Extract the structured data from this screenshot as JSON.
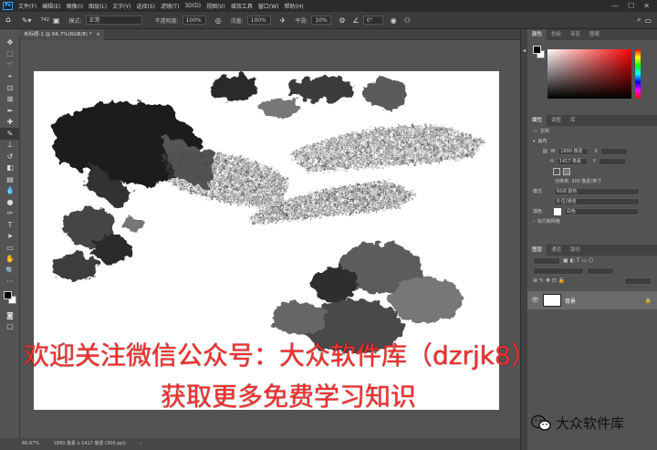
{
  "menubar": {
    "logo": "Ps",
    "items": [
      "文件(F)",
      "编辑(E)",
      "图像(I)",
      "图层(L)",
      "文字(Y)",
      "选择(S)",
      "滤镜(T)",
      "3D(D)",
      "视图(V)",
      "增效工具",
      "窗口(W)",
      "帮助(H)"
    ],
    "window_buttons": [
      "—",
      "☐",
      "✕"
    ]
  },
  "options": {
    "brush_size": "742",
    "mode_label": "模式:",
    "mode_value": "正常",
    "opacity_label": "不透明度:",
    "opacity_value": "100%",
    "flow_label": "流量:",
    "flow_value": "100%",
    "smooth_label": "平滑:",
    "smooth_value": "10%",
    "angle_value": "0°"
  },
  "document": {
    "tab_title": "未标题-1 @ 66.7%(RGB/8) *",
    "tab_close": "×"
  },
  "status": {
    "zoom": "66.67%",
    "info": "1890 像素 x 1417 像素 (300 ppi)",
    "arrow": "›"
  },
  "right_panel": {
    "color_tabs": [
      "颜色",
      "色板",
      "渐变",
      "图案"
    ],
    "props_tabs": [
      "属性",
      "调整",
      "库"
    ],
    "doc_label": "文档",
    "canvas_section": "画布",
    "w_label": "W",
    "w_value": "1890 像素",
    "h_label": "H",
    "h_value": "1417 像素",
    "x_label": "X",
    "y_label": "Y",
    "resolution": "分辨率: 300 像素/英寸",
    "mode_label": "模式",
    "mode_value": "RGB 颜色",
    "bit_value": "8 位/通道",
    "fill_label": "填色",
    "fill_value": "白色",
    "rulers_label": "标尺和网格",
    "layers_tabs": [
      "图层",
      "通道",
      "路径"
    ],
    "layer_name": "背景"
  },
  "watermark": {
    "line1": "欢迎关注微信公众号：大众软件库（dzrjk8）",
    "line2": "获取更多免费学习知识"
  },
  "brand": {
    "icon": "wechat-icon",
    "text": "大众软件库"
  },
  "colors": {
    "accent_red": "#ff2d2d",
    "ps_blue": "#2fa3f6",
    "foreground": "#000000",
    "background": "#ffffff"
  }
}
